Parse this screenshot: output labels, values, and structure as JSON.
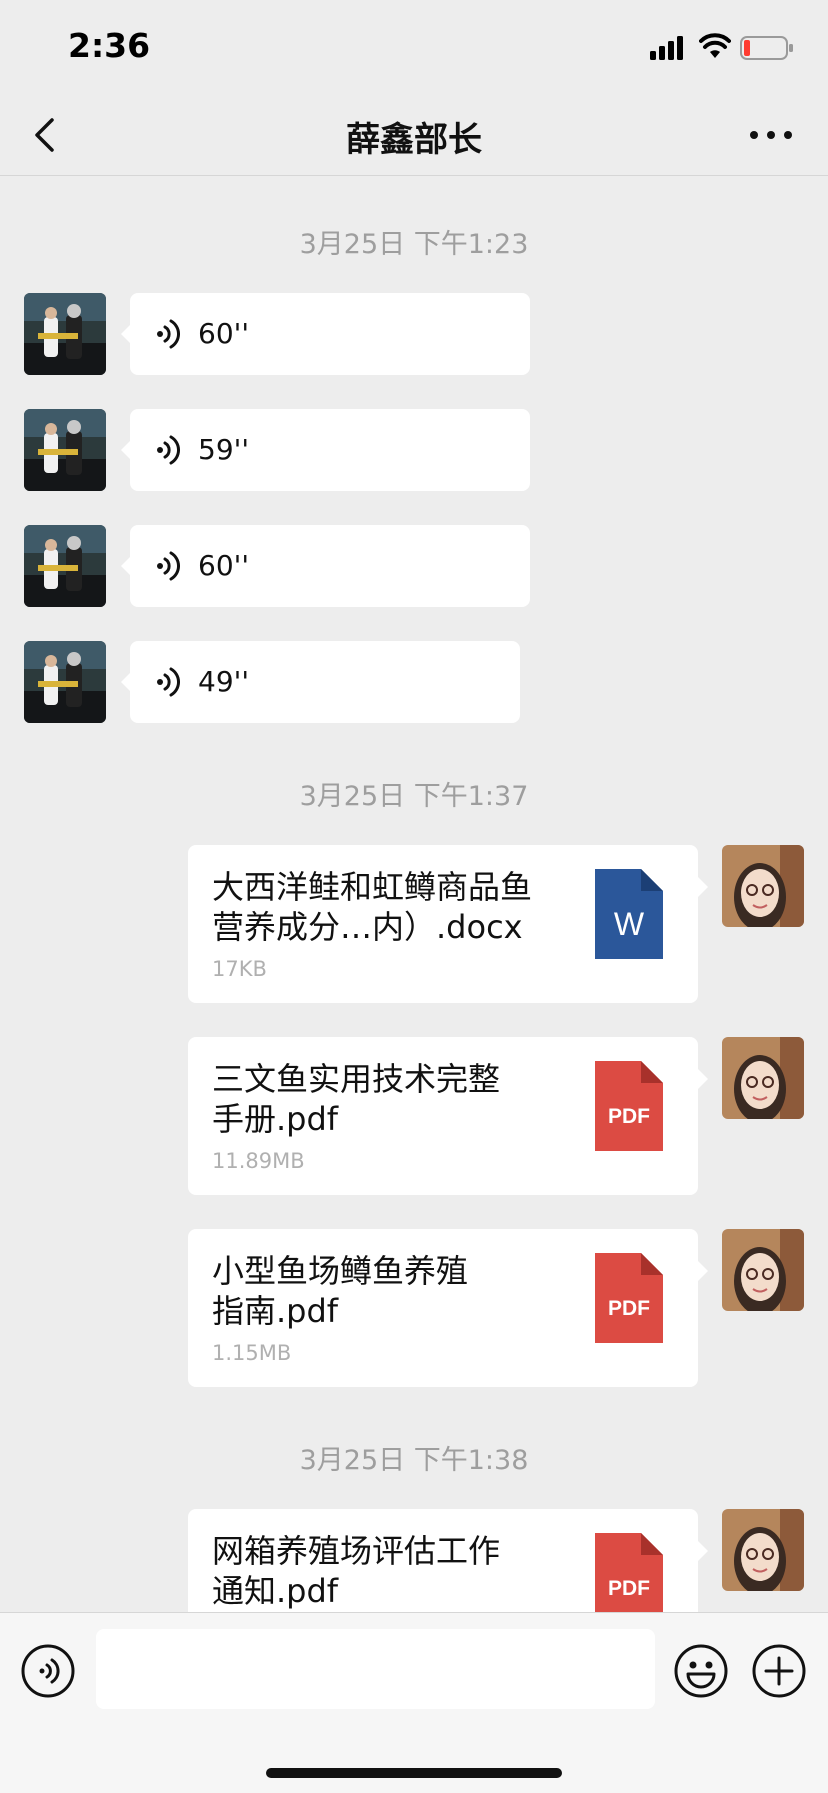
{
  "status_bar": {
    "time": "2:36",
    "icons": [
      "signal-icon",
      "wifi-icon",
      "battery-icon"
    ]
  },
  "nav": {
    "title": "薛鑫部长",
    "back_icon": "chevron-left-icon",
    "more_icon": "more-dots-icon"
  },
  "messages": {
    "group1": {
      "timestamp": "3月25日 下午1:23",
      "voices": [
        {
          "duration": "60''"
        },
        {
          "duration": "59''"
        },
        {
          "duration": "60''"
        },
        {
          "duration": "49''"
        }
      ]
    },
    "group2": {
      "timestamp": "3月25日 下午1:37",
      "files": [
        {
          "name_line1": "大西洋鲑和虹鳟商品鱼",
          "name_line2": "营养成分…内）.docx",
          "size": "17KB",
          "icon_label": "W",
          "icon_color": "#2b579a"
        },
        {
          "name_line1": "三文鱼实用技术完整",
          "name_line2": "手册.pdf",
          "size": "11.89MB",
          "icon_label": "PDF",
          "icon_color": "#dc4b43"
        },
        {
          "name_line1": "小型鱼场鳟鱼养殖",
          "name_line2": "指南.pdf",
          "size": "1.15MB",
          "icon_label": "PDF",
          "icon_color": "#dc4b43"
        }
      ]
    },
    "group3": {
      "timestamp": "3月25日 下午1:38",
      "files": [
        {
          "name_line1": "网箱养殖场评估工作",
          "name_line2": "通知.pdf",
          "icon_label": "PDF",
          "icon_color": "#dc4b43"
        }
      ]
    }
  },
  "input_bar": {
    "voice_icon": "voice-toggle-icon",
    "emoji_icon": "emoji-icon",
    "plus_icon": "plus-icon"
  }
}
